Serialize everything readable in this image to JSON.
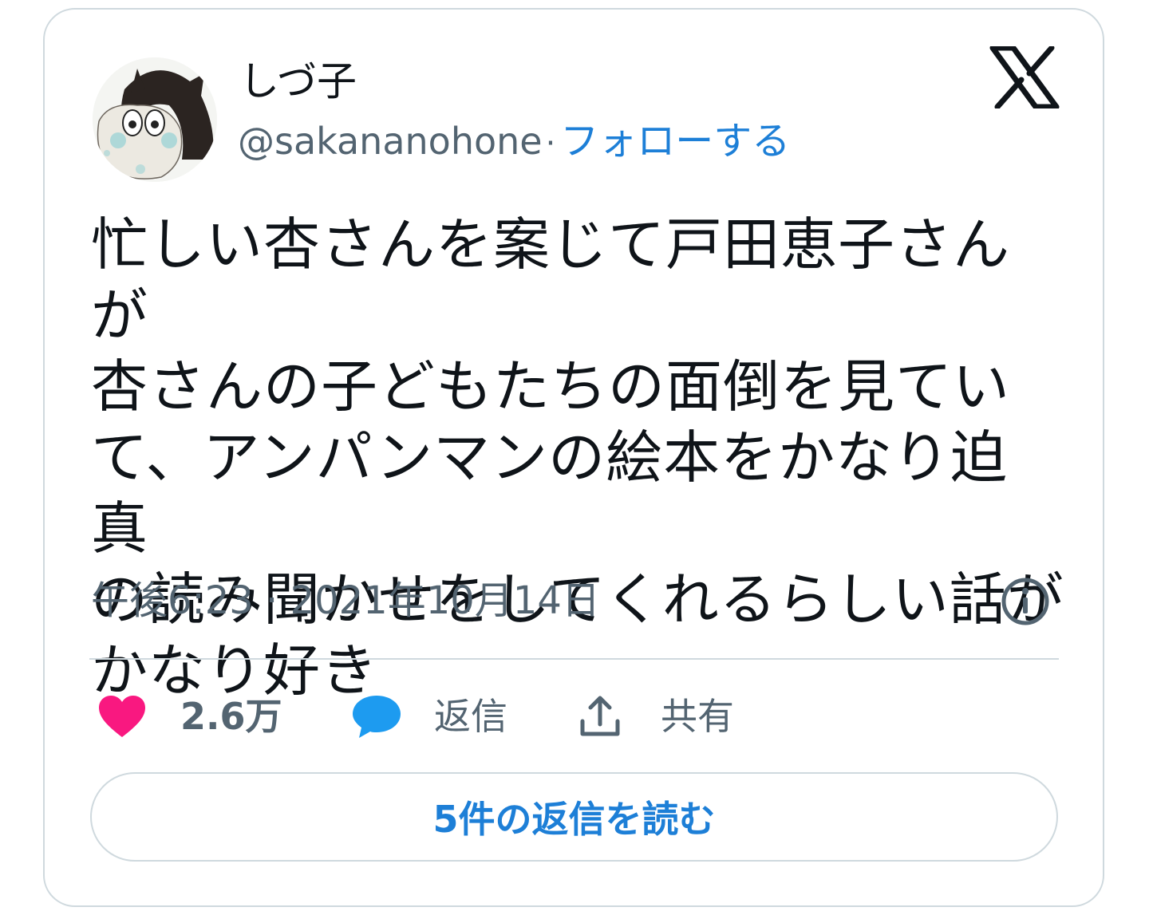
{
  "author": {
    "display_name": "しづ子",
    "handle": "@sakananohone",
    "separator": "·",
    "follow_label": "フォローする"
  },
  "tweet": {
    "text": "忙しい杏さんを案じて戸田恵子さんが\n杏さんの子どもたちの面倒を見てい\nて、アンパンマンの絵本をかなり迫真\nの読み聞かせをしてくれるらしい話が\nかなり好き",
    "timestamp": "午後6:23 · 2021年10月14日"
  },
  "actions": {
    "like_count": "2.6万",
    "reply_label": "返信",
    "share_label": "共有"
  },
  "read_replies_label": "5件の返信を読む",
  "icons": {
    "brand": "x-logo-icon",
    "like": "heart-icon",
    "reply": "speech-bubble-icon",
    "share": "share-upload-icon",
    "info": "info-icon"
  },
  "colors": {
    "accent": "#1d7fd7",
    "like": "#f91880",
    "reply_icon": "#1d9bf0",
    "text_primary": "#0f1419",
    "text_secondary": "#536471",
    "border": "#cfd9de"
  }
}
